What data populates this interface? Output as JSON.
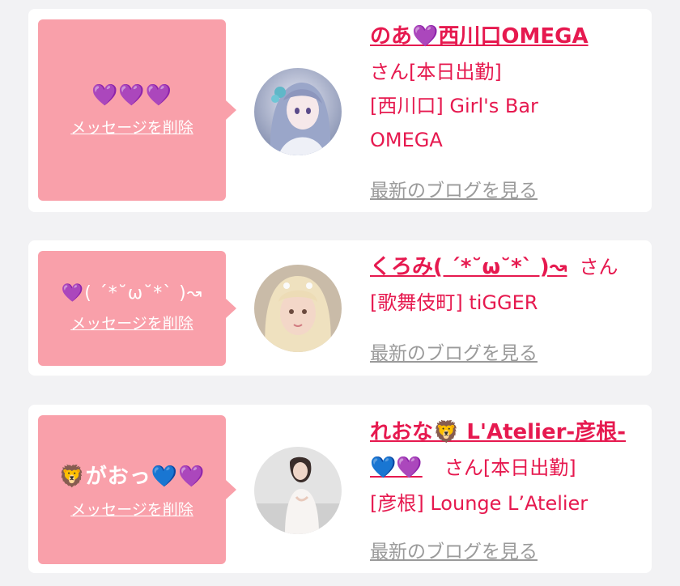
{
  "colors": {
    "accent": "#e6194f",
    "bubble": "#f9a0aa",
    "link_gray": "#9a9a9a"
  },
  "cards": [
    {
      "message": "💜💜💜",
      "delete_label": "メッセージを削除",
      "avatar": "avatar-anime-girl",
      "name": "のあ💜西川口OMEGA",
      "suffix": "さん[本日出勤]",
      "shop": "[西川口] Girl's Bar OMEGA",
      "shop_line1": "[西川口] Girl's Bar",
      "shop_line2": "OMEGA",
      "blog_label": "最新のブログを見る"
    },
    {
      "message": "💜( ˊ*˘ω˘*ˋ )↝",
      "delete_label": "メッセージを削除",
      "avatar": "avatar-blonde-girl",
      "name": "くろみ( ˊ*˘ω˘*ˋ )↝",
      "suffix": "さん",
      "shop": "[歌舞伎町] tiGGER",
      "blog_label": "最新のブログを見る"
    },
    {
      "message": "🦁がおっ💙💜",
      "delete_label": "メッセージを削除",
      "avatar": "avatar-woman-photo",
      "name_line1": "れおな🦁 L'Atelier-彦根-",
      "name_line2": "💙💜",
      "suffix": "さん[本日出勤]",
      "shop": "[彦根] Lounge L’Atelier",
      "blog_label": "最新のブログを見る"
    }
  ]
}
